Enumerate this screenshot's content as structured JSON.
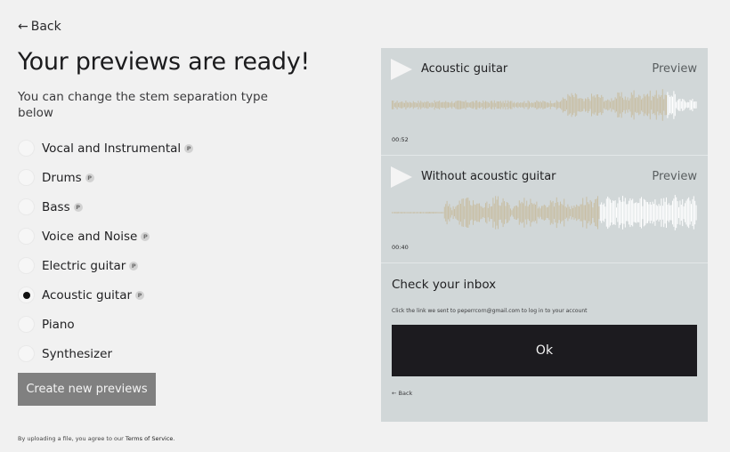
{
  "back": {
    "arrow": "←",
    "label": "Back"
  },
  "title": "Your previews are ready!",
  "subtitle": "You can change the stem separation type below",
  "options": [
    {
      "label": "Vocal and Instrumental",
      "premium": true,
      "selected": false
    },
    {
      "label": "Drums",
      "premium": true,
      "selected": false
    },
    {
      "label": "Bass",
      "premium": true,
      "selected": false
    },
    {
      "label": "Voice and Noise",
      "premium": true,
      "selected": false
    },
    {
      "label": "Electric guitar",
      "premium": true,
      "selected": false
    },
    {
      "label": "Acoustic guitar",
      "premium": true,
      "selected": true
    },
    {
      "label": "Piano",
      "premium": false,
      "selected": false
    },
    {
      "label": "Synthesizer",
      "premium": false,
      "selected": false
    }
  ],
  "premium_badge": "P",
  "create_button": "Create new previews",
  "terms": {
    "text": "By uploading a file, you agree to our ",
    "link": "Terms of Service",
    "end": "."
  },
  "tracks": [
    {
      "title": "Acoustic guitar",
      "preview": "Preview",
      "time": "00:52",
      "played_fraction": 0.9
    },
    {
      "title": "Without acoustic guitar",
      "preview": "Preview",
      "time": "00:40",
      "played_fraction": 0.68
    }
  ],
  "inbox": {
    "title": "Check your inbox",
    "note_pre": "Click the link we sent to ",
    "email": "peperrcorn@gmail.com",
    "note_post": " to log in to your account",
    "ok_label": "Ok",
    "back_label": "← Back"
  },
  "colors": {
    "wave_played": "#c8bfa5",
    "wave_unplayed": "#ffffff",
    "panel_bg": "#d1d7d8",
    "button_dark": "#1c1b1f",
    "button_gray": "#808080"
  }
}
